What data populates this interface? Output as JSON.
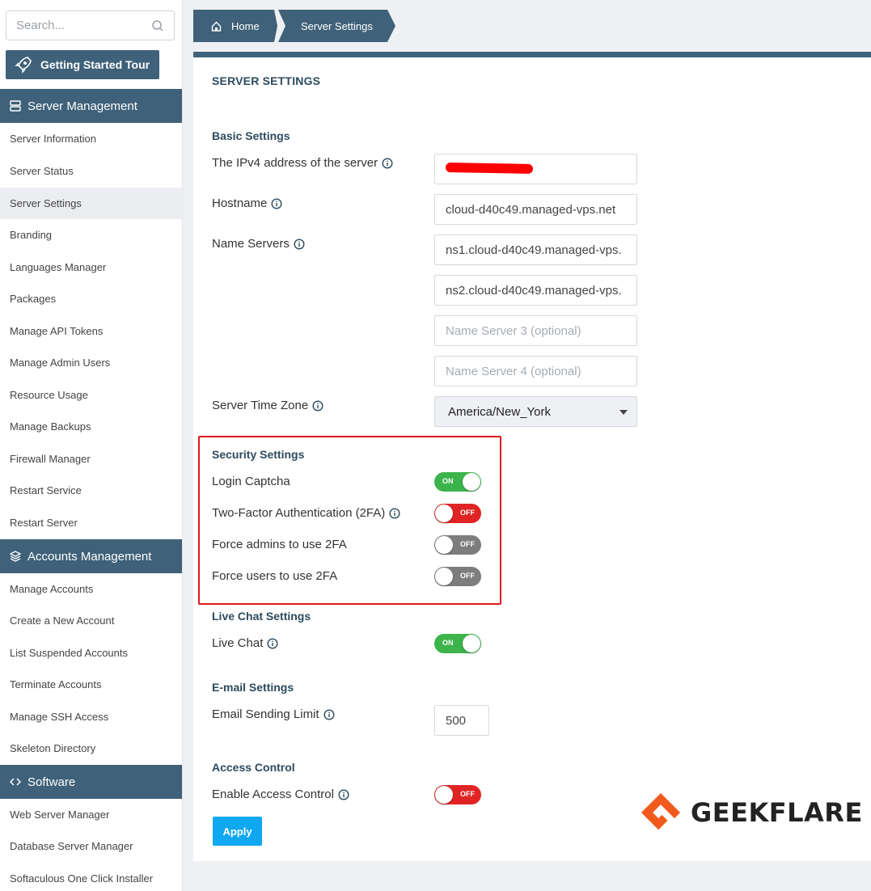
{
  "sidebar": {
    "search_placeholder": "Search...",
    "tour_label": "Getting Started Tour",
    "sections": [
      {
        "title": "Server Management",
        "icon": "server-icon"
      },
      {
        "title": "Accounts Management",
        "icon": "layers-icon"
      },
      {
        "title": "Software",
        "icon": "code-icon"
      }
    ],
    "server_items": [
      "Server Information",
      "Server Status",
      "Server Settings",
      "Branding",
      "Languages Manager",
      "Packages",
      "Manage API Tokens",
      "Manage Admin Users",
      "Resource Usage",
      "Manage Backups",
      "Firewall Manager",
      "Restart Service",
      "Restart Server"
    ],
    "account_items": [
      "Manage Accounts",
      "Create a New Account",
      "List Suspended Accounts",
      "Terminate Accounts",
      "Manage SSH Access",
      "Skeleton Directory"
    ],
    "software_items": [
      "Web Server Manager",
      "Database Server Manager",
      "Softaculous One Click Installer"
    ],
    "active_item": "Server Settings"
  },
  "breadcrumb": {
    "home": "Home",
    "current": "Server Settings"
  },
  "panel": {
    "title": "SERVER SETTINGS",
    "basic": {
      "heading": "Basic Settings",
      "ip_label": "The IPv4 address of the server",
      "ip_value": "",
      "hostname_label": "Hostname",
      "hostname_value": "cloud-d40c49.managed-vps.net",
      "ns_label": "Name Servers",
      "ns1_value": "ns1.cloud-d40c49.managed-vps.",
      "ns2_value": "ns2.cloud-d40c49.managed-vps.",
      "ns3_placeholder": "Name Server 3 (optional)",
      "ns4_placeholder": "Name Server 4 (optional)",
      "timezone_label": "Server Time Zone",
      "timezone_value": "America/New_York"
    },
    "security": {
      "heading": "Security Settings",
      "captcha_label": "Login Captcha",
      "captcha_state": "ON",
      "twofa_label": "Two-Factor Authentication (2FA)",
      "twofa_state": "OFF",
      "force_admins_label": "Force admins to use 2FA",
      "force_admins_state": "OFF",
      "force_users_label": "Force users to use 2FA",
      "force_users_state": "OFF"
    },
    "livechat": {
      "heading": "Live Chat Settings",
      "label": "Live Chat",
      "state": "ON"
    },
    "email": {
      "heading": "E-mail Settings",
      "label": "Email Sending Limit",
      "value": "500"
    },
    "access": {
      "heading": "Access Control",
      "label": "Enable Access Control",
      "state": "OFF"
    },
    "apply_label": "Apply"
  },
  "watermark": "GEEKFLARE",
  "colors": {
    "primary": "#3f6179",
    "on": "#3cb44b",
    "off_red": "#e02424",
    "off_grey": "#7d7d7d",
    "apply": "#0fa7ef",
    "highlight": "#e01b1b",
    "logo": "#f25a1d"
  }
}
